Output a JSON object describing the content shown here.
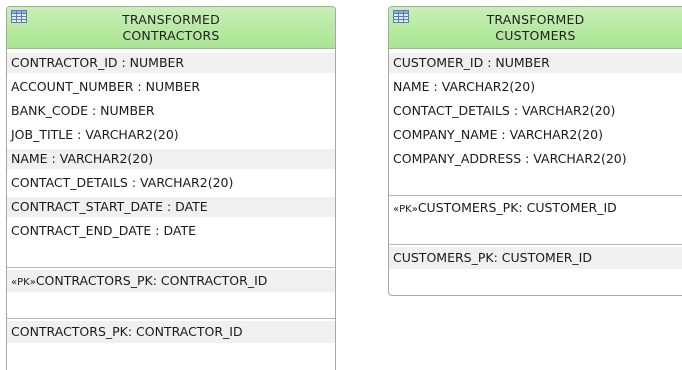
{
  "entities": {
    "contractors": {
      "title_line1": "TRANSFORMED",
      "title_line2": "CONTRACTORS",
      "columns": [
        "CONTRACTOR_ID : NUMBER",
        "ACCOUNT_NUMBER : NUMBER",
        "BANK_CODE : NUMBER",
        "JOB_TITLE : VARCHAR2(20)",
        "NAME : VARCHAR2(20)",
        "CONTACT_DETAILS : VARCHAR2(20)",
        "CONTRACT_START_DATE : DATE",
        "CONTRACT_END_DATE : DATE"
      ],
      "pk_stereotype": "«PK»",
      "pk_constraint": "CONTRACTORS_PK: CONTRACTOR_ID",
      "index": "CONTRACTORS_PK: CONTRACTOR_ID"
    },
    "customers": {
      "title_line1": "TRANSFORMED",
      "title_line2": "CUSTOMERS",
      "columns": [
        "CUSTOMER_ID : NUMBER",
        "NAME : VARCHAR2(20)",
        "CONTACT_DETAILS : VARCHAR2(20)",
        "COMPANY_NAME : VARCHAR2(20)",
        "COMPANY_ADDRESS : VARCHAR2(20)"
      ],
      "pk_stereotype": "«PK»",
      "pk_constraint": "CUSTOMERS_PK: CUSTOMER_ID",
      "index": "CUSTOMERS_PK: CUSTOMER_ID"
    }
  },
  "icons": {
    "table": "table-icon"
  },
  "colors": {
    "header_green": "#b5e9a0",
    "border": "#a7a7a7",
    "band": "#f0f0f0"
  }
}
